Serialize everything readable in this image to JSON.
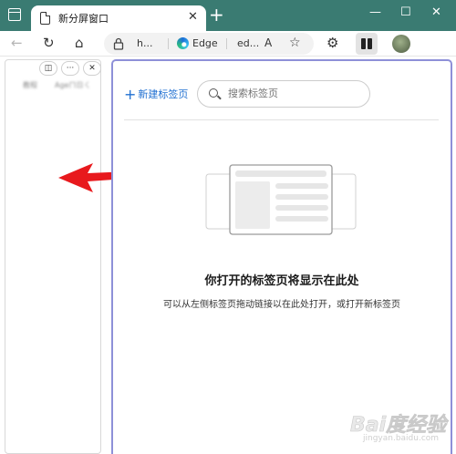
{
  "tab": {
    "title": "新分屏窗口",
    "close": "✕",
    "new_tab": "+"
  },
  "window_controls": {
    "minimize": "—",
    "maximize": "☐",
    "close": "✕"
  },
  "toolbar": {
    "back": "←",
    "refresh": "↻",
    "home": "⌂",
    "address_part1": "h...",
    "address_site": "Edge",
    "address_part2": "ed...",
    "read_aloud": "A",
    "favorite": "☆",
    "extensions": "⚙"
  },
  "left_pane": {
    "split_btn": "◫",
    "more_btn": "···",
    "close_btn": "✕",
    "blur1": "教程",
    "blur2": "Ageㄇㄖㄑ"
  },
  "right_pane": {
    "new_tab_label": "新建标签页",
    "search_placeholder": "搜索标签页",
    "empty_title": "你打开的标签页将显示在此处",
    "empty_subtitle": "可以从左侧标签页拖动链接以在此处打开，或打开新标签页"
  },
  "watermark": {
    "logo": "Bai度经验",
    "url": "jingyan.baidu.com"
  },
  "colors": {
    "titlebar": "#3a7b72",
    "accent_blue": "#1f6fd1",
    "pane_border": "#8e90d8",
    "arrow_red": "#e8191d"
  }
}
